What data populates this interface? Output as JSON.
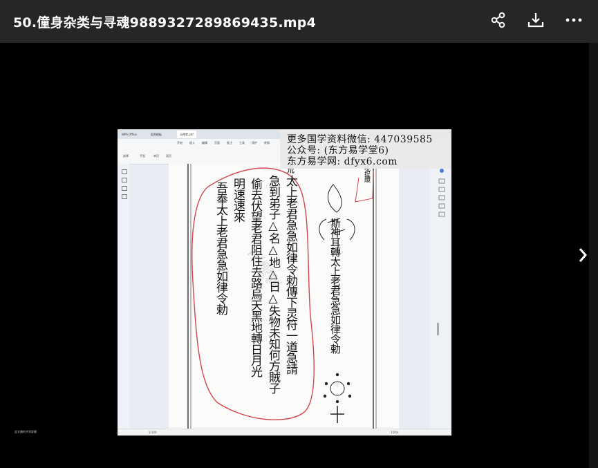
{
  "header": {
    "title": "50.僮身杂类与寻魂9889327289869435.mp4",
    "share_icon": "share-icon",
    "download_icon": "download-icon",
    "more_icon": "more-icon"
  },
  "player": {
    "next_icon": "chevron-right-icon",
    "caption": "此文播的共享屏幕"
  },
  "app": {
    "tabs": [
      "WPS Office",
      "稻壳模板",
      "王德堂.pdf"
    ],
    "menu": [
      "开始",
      "插入",
      "编辑",
      "页面",
      "批注",
      "工具",
      "保护",
      "转换"
    ],
    "tools": [
      "选择",
      "手型",
      "单页",
      "双页"
    ],
    "zoom": "150%",
    "page_indicator": "1/100"
  },
  "watermark": {
    "line1": "更多国学资料微信: 447039585",
    "line2": "公众号: (东方易学堂6)",
    "line3": "东方易学网: dfyx6.com"
  },
  "document": {
    "talisman_top_chars": "斯神耳轉太上老君急急如律令勅",
    "side_note": "呪提纜",
    "col1": "太上老君急急如律令勅傳下灵符一道急請",
    "col2": "急到弟子△名△地△日△失物未知何方賊子",
    "col3": "偷去伏望老君阻住去路烏天黑地轉日月光",
    "col4": "明速速來",
    "col5": "吾奉太上老君急急如律令勅",
    "top_symbol": "㐬"
  }
}
